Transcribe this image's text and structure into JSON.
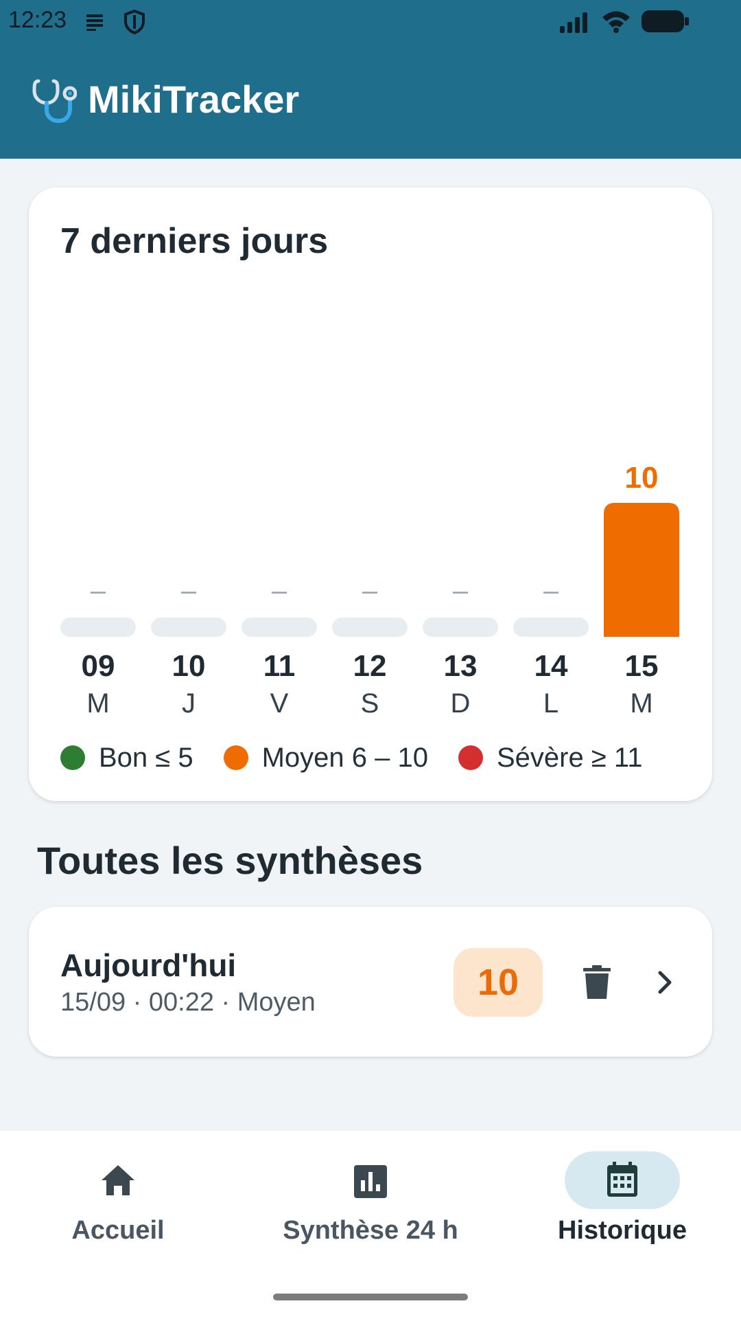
{
  "status_bar": {
    "time": "12:23",
    "left_icons": [
      "notes-icon",
      "shield-icon"
    ],
    "right_icons": [
      "signal-icon",
      "wifi-icon",
      "battery-icon"
    ]
  },
  "app_bar": {
    "title": "MikiTracker",
    "logo_icon": "stethoscope-icon"
  },
  "chart_card": {
    "title": "7 derniers jours"
  },
  "chart_data": {
    "type": "bar",
    "title": "7 derniers jours",
    "categories": [
      "09",
      "10",
      "11",
      "12",
      "13",
      "14",
      "15"
    ],
    "day_letters": [
      "M",
      "J",
      "V",
      "S",
      "D",
      "L",
      "M"
    ],
    "values": [
      null,
      null,
      null,
      null,
      null,
      null,
      10
    ],
    "value_labels": [
      "–",
      "–",
      "–",
      "–",
      "–",
      "–",
      "10"
    ],
    "ylim": [
      0,
      20
    ],
    "grid": false,
    "colors": {
      "empty": "#e7edf1",
      "empty_label": "#9aa6ae",
      "moyen": "#ef6c00"
    },
    "legend": {
      "placement": "bottom",
      "items": [
        {
          "label": "Bon ≤ 5",
          "color": "#2e7d32"
        },
        {
          "label": "Moyen 6 – 10",
          "color": "#ef6c00"
        },
        {
          "label": "Sévère ≥ 11",
          "color": "#d32f2f"
        }
      ]
    }
  },
  "section": {
    "title": "Toutes les synthèses"
  },
  "entries": [
    {
      "title": "Aujourd'hui",
      "subtitle": "15/09 · 00:22 · Moyen",
      "score": "10",
      "delete_icon": "trash-icon",
      "open_icon": "chevron-right-icon"
    }
  ],
  "bottom_nav": {
    "items": [
      {
        "label": "Accueil",
        "icon": "home-icon",
        "active": false
      },
      {
        "label": "Synthèse 24 h",
        "icon": "bar-chart-icon",
        "active": false
      },
      {
        "label": "Historique",
        "icon": "calendar-icon",
        "active": true
      }
    ]
  },
  "colors": {
    "primary": "#1f6e8c",
    "background": "#f1f4f7",
    "accent_orange": "#ef6c00",
    "badge_bg": "#fde4cc",
    "nav_active_pill": "#d6e9f0"
  }
}
